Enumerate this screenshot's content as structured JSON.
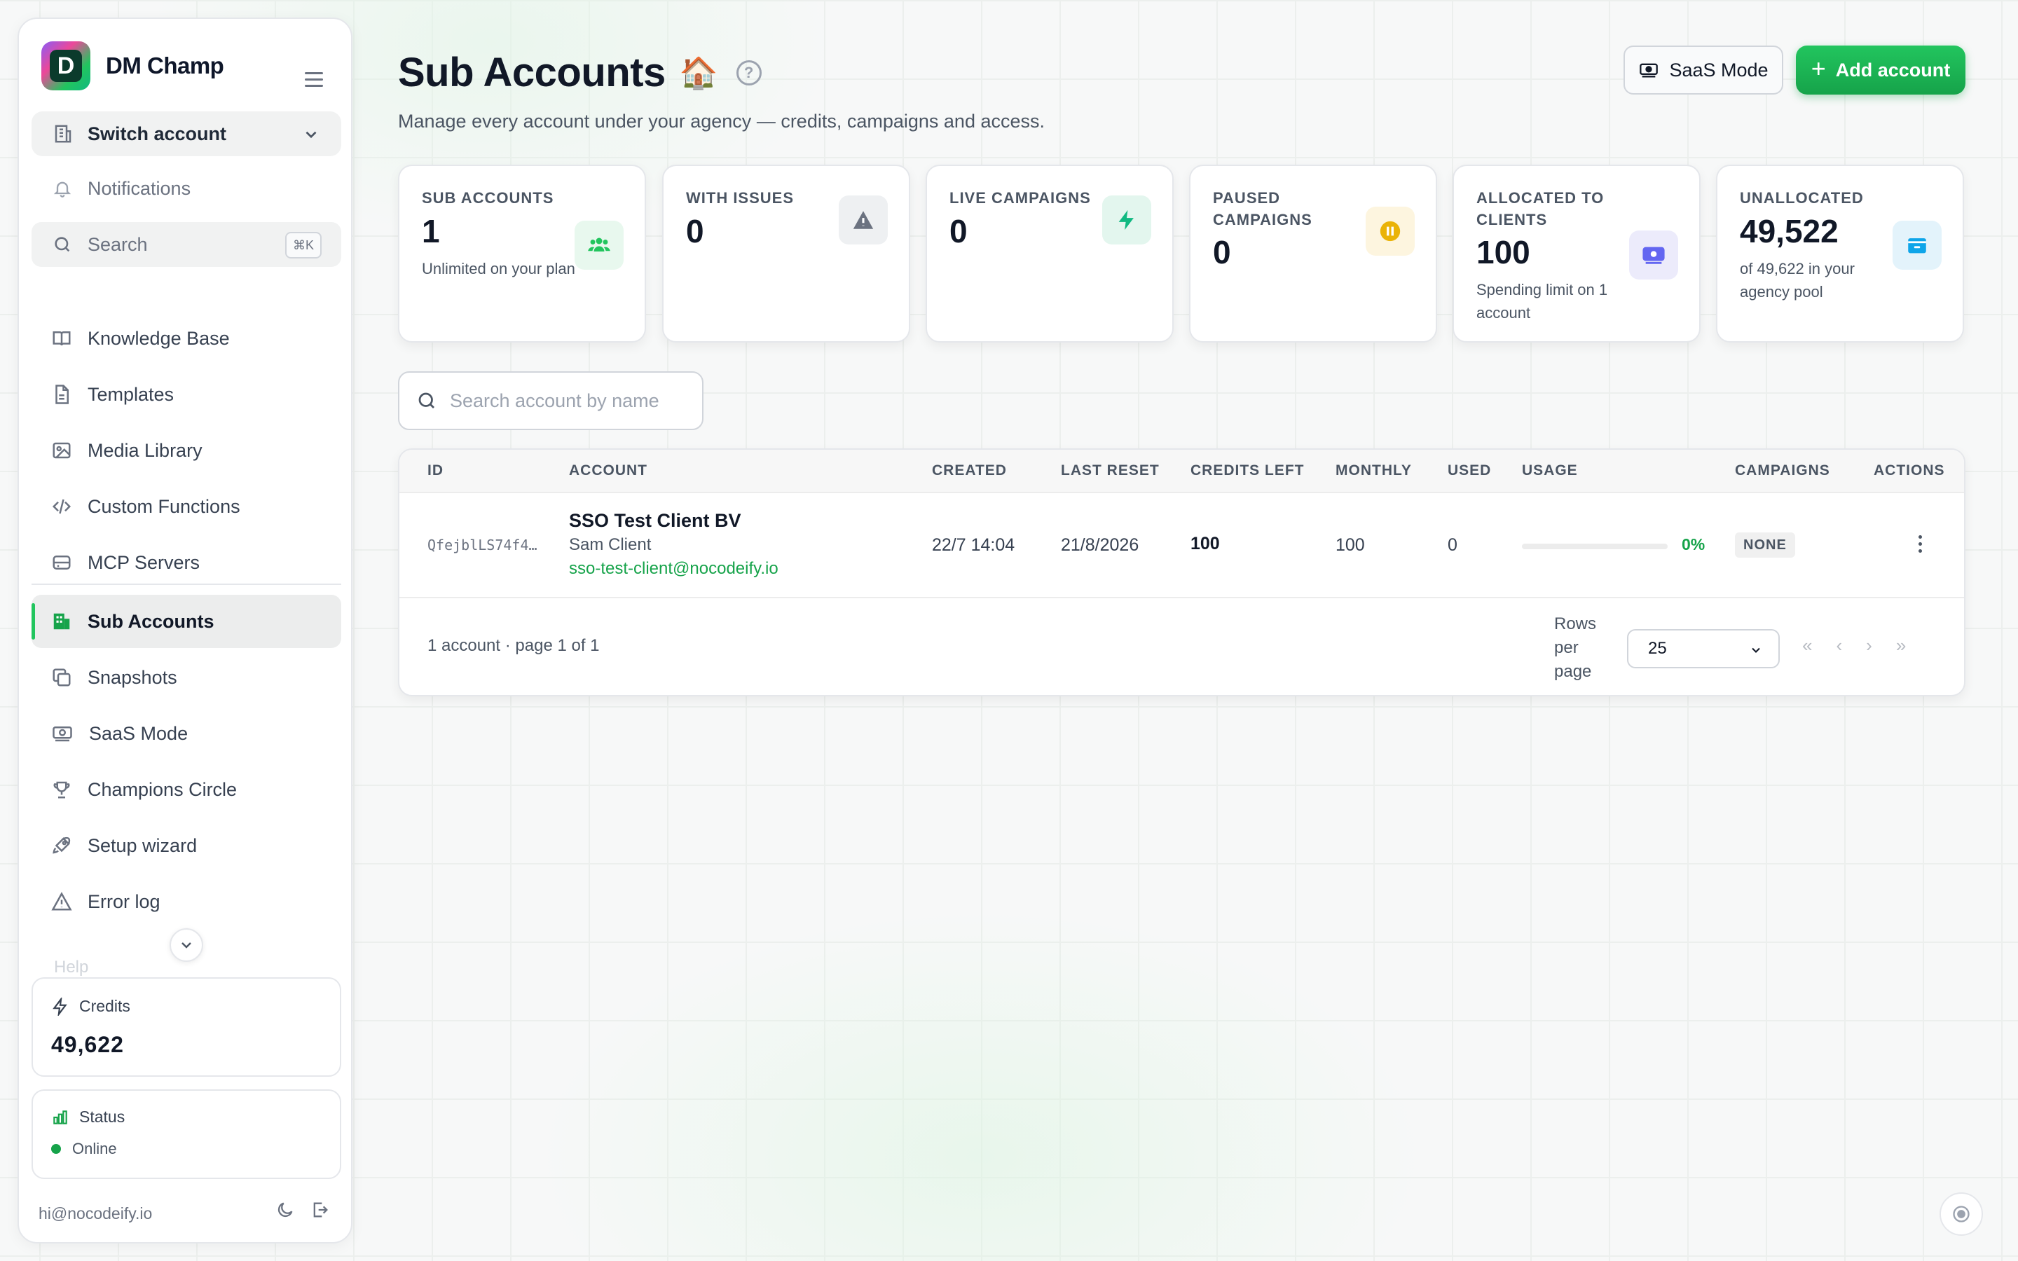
{
  "brand": {
    "name": "DM Champ",
    "logo_letter": "D"
  },
  "sidebar": {
    "switch_account": "Switch account",
    "notifications": "Notifications",
    "search_label": "Search",
    "search_shortcut": "⌘K",
    "items": [
      {
        "label": "Knowledge Base",
        "icon": "book-icon"
      },
      {
        "label": "Templates",
        "icon": "document-icon"
      },
      {
        "label": "Media Library",
        "icon": "image-icon"
      },
      {
        "label": "Custom Functions",
        "icon": "code-icon"
      },
      {
        "label": "MCP Servers",
        "icon": "server-icon"
      }
    ],
    "items2": [
      {
        "label": "Sub Accounts",
        "icon": "building-icon",
        "active": true
      },
      {
        "label": "Snapshots",
        "icon": "copy-icon"
      },
      {
        "label": "SaaS Mode",
        "icon": "money-icon"
      },
      {
        "label": "Champions Circle",
        "icon": "trophy-icon"
      },
      {
        "label": "Setup wizard",
        "icon": "rocket-icon"
      },
      {
        "label": "Error log",
        "icon": "warning-icon"
      }
    ],
    "faded_item": "Help",
    "credits": {
      "title": "Credits",
      "value": "49,622"
    },
    "status": {
      "title": "Status",
      "value": "Online"
    },
    "footer_email": "hi@nocodeify.io"
  },
  "header": {
    "title": "Sub Accounts",
    "title_emoji": "🏠",
    "help": "?",
    "subtitle": "Manage every account under your agency — credits, campaigns and access.",
    "saas_button": "SaaS Mode",
    "add_button": "Add account"
  },
  "stats": [
    {
      "label": "SUB ACCOUNTS",
      "value": "1",
      "note": "Unlimited on your plan",
      "icon": "users-icon",
      "color": "#22c55e",
      "bg": "#e8f8ee"
    },
    {
      "label": "WITH ISSUES",
      "value": "0",
      "note": "",
      "icon": "warning-icon",
      "color": "#6b7280",
      "bg": "#eef0f2"
    },
    {
      "label": "LIVE CAMPAIGNS",
      "value": "0",
      "note": "",
      "icon": "bolt-icon",
      "color": "#10b981",
      "bg": "#e3f6ee"
    },
    {
      "label": "PAUSED CAMPAIGNS",
      "value": "0",
      "note": "",
      "icon": "pause-icon",
      "color": "#eab308",
      "bg": "#fdf5df"
    },
    {
      "label": "ALLOCATED TO CLIENTS",
      "value": "100",
      "note": "Spending limit on 1 account",
      "icon": "money-icon",
      "color": "#6366f1",
      "bg": "#ecebfb"
    },
    {
      "label": "UNALLOCATED",
      "value": "49,522",
      "note": "of 49,622 in your agency pool",
      "icon": "wallet-icon",
      "color": "#0ea5e9",
      "bg": "#e3f3fb"
    }
  ],
  "search": {
    "placeholder": "Search account by name"
  },
  "table": {
    "columns": [
      "ID",
      "ACCOUNT",
      "CREATED",
      "LAST RESET",
      "CREDITS LEFT",
      "MONTHLY",
      "USED",
      "USAGE",
      "CAMPAIGNS",
      "ACTIONS"
    ],
    "rows": [
      {
        "id": "QfejblLS74f4…",
        "name": "SSO Test Client BV",
        "contact": "Sam Client",
        "email": "sso-test-client@nocodeify.io",
        "created": "22/7 14:04",
        "last_reset": "21/8/2026",
        "credits_left": "100",
        "monthly": "100",
        "used": "0",
        "usage_pct": "0%",
        "usage_fraction": 0,
        "campaigns": "NONE"
      }
    ],
    "footer_info": "1 account · page 1 of 1",
    "rows_per_page_label": "Rows per page",
    "rows_per_page": "25",
    "pager": [
      "«",
      "‹",
      "›",
      "»"
    ]
  }
}
